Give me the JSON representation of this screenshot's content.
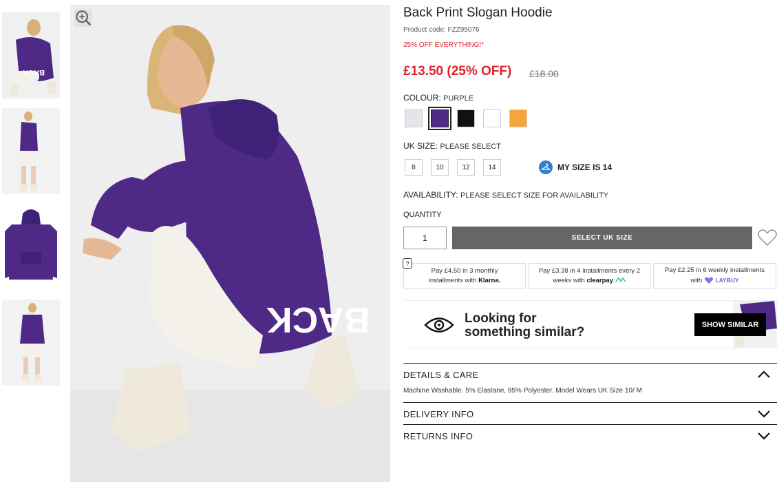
{
  "product": {
    "title": "Back Print Slogan Hoodie",
    "code": "Product code: FZZ95076",
    "promo": "25% OFF EVERYTHING!*",
    "price": "£13.50 (25% OFF)",
    "old_price": "£18.00"
  },
  "colour": {
    "label": "COLOUR:",
    "selected": "PURPLE",
    "swatches": [
      {
        "name": "grey",
        "hex": "#e4e4ea"
      },
      {
        "name": "purple",
        "hex": "#4e2a86"
      },
      {
        "name": "black",
        "hex": "#111111"
      },
      {
        "name": "white",
        "hex": "#ffffff"
      },
      {
        "name": "orange",
        "hex": "#f5a53a"
      }
    ]
  },
  "size": {
    "label": "UK SIZE:",
    "value": "PLEASE SELECT",
    "options": [
      "8",
      "10",
      "12",
      "14"
    ],
    "my_size": "MY SIZE IS 14"
  },
  "availability": {
    "label": "AVAILABILITY:",
    "value": "PLEASE SELECT SIZE FOR AVAILABILITY"
  },
  "quantity": {
    "label": "QUANTITY",
    "value": "1"
  },
  "cta": {
    "label": "SELECT UK SIZE"
  },
  "help_label": "?",
  "installments": [
    {
      "pre": "Pay",
      "amount": "£4.50",
      "mid": "in 3 monthly",
      "post": "installments with",
      "brand": "Klarna."
    },
    {
      "pre": "Pay",
      "amount": "£3.38",
      "mid": "in 4 installments every 2",
      "post": "weeks with",
      "brand": "clearpay"
    },
    {
      "pre": "Pay",
      "amount": "£2.25",
      "mid": "in 6 weekly installments",
      "post": "with",
      "brand": "LAYBUY"
    }
  ],
  "similar": {
    "line1": "Looking for",
    "line2": "something similar?",
    "button": "SHOW SIMILAR"
  },
  "accordion": {
    "details": {
      "title": "DETAILS & CARE",
      "text": "Machine Washable. 5% Elastane, 95% Polyester. Model Wears UK Size 10/ M"
    },
    "delivery": {
      "title": "DELIVERY INFO"
    },
    "returns": {
      "title": "RETURNS INFO"
    }
  },
  "image_text": {
    "back_print": "BACK"
  },
  "colors": {
    "sale_red": "#e5202a",
    "hoodie_purple": "#4e2a86",
    "cta_grey": "#666666",
    "mysize_blue": "#2d7fd2"
  }
}
